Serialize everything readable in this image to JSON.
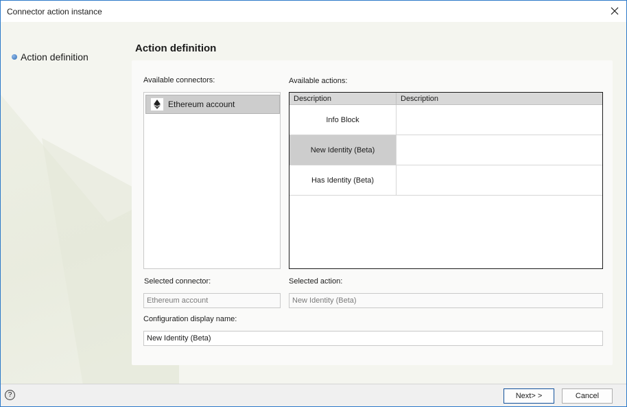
{
  "window": {
    "title": "Connector action instance",
    "close_icon": "close-icon"
  },
  "nav": {
    "items": [
      {
        "label": "Action definition"
      }
    ]
  },
  "main": {
    "heading": "Action definition",
    "available_connectors_label": "Available connectors:",
    "connectors": [
      {
        "label": "Ethereum account",
        "icon": "ethereum-icon"
      }
    ],
    "available_actions_label": "Available actions:",
    "actions_table": {
      "columns": [
        "Description",
        "Description"
      ],
      "rows": [
        {
          "name": "Info Block",
          "description": ""
        },
        {
          "name": "New Identity (Beta)",
          "description": "",
          "selected": true
        },
        {
          "name": "Has Identity (Beta)",
          "description": ""
        }
      ]
    },
    "selected_connector_label": "Selected connector:",
    "selected_connector_value": "Ethereum account",
    "selected_action_label": "Selected action:",
    "selected_action_value": "New Identity (Beta)",
    "config_name_label": "Configuration display name:",
    "config_name_value": "New Identity (Beta)"
  },
  "footer": {
    "help_icon": "help-icon",
    "help_glyph": "?",
    "next_label": "Next> >",
    "cancel_label": "Cancel"
  },
  "colors": {
    "accent": "#2b79c9",
    "selection": "#cdcdcd"
  }
}
